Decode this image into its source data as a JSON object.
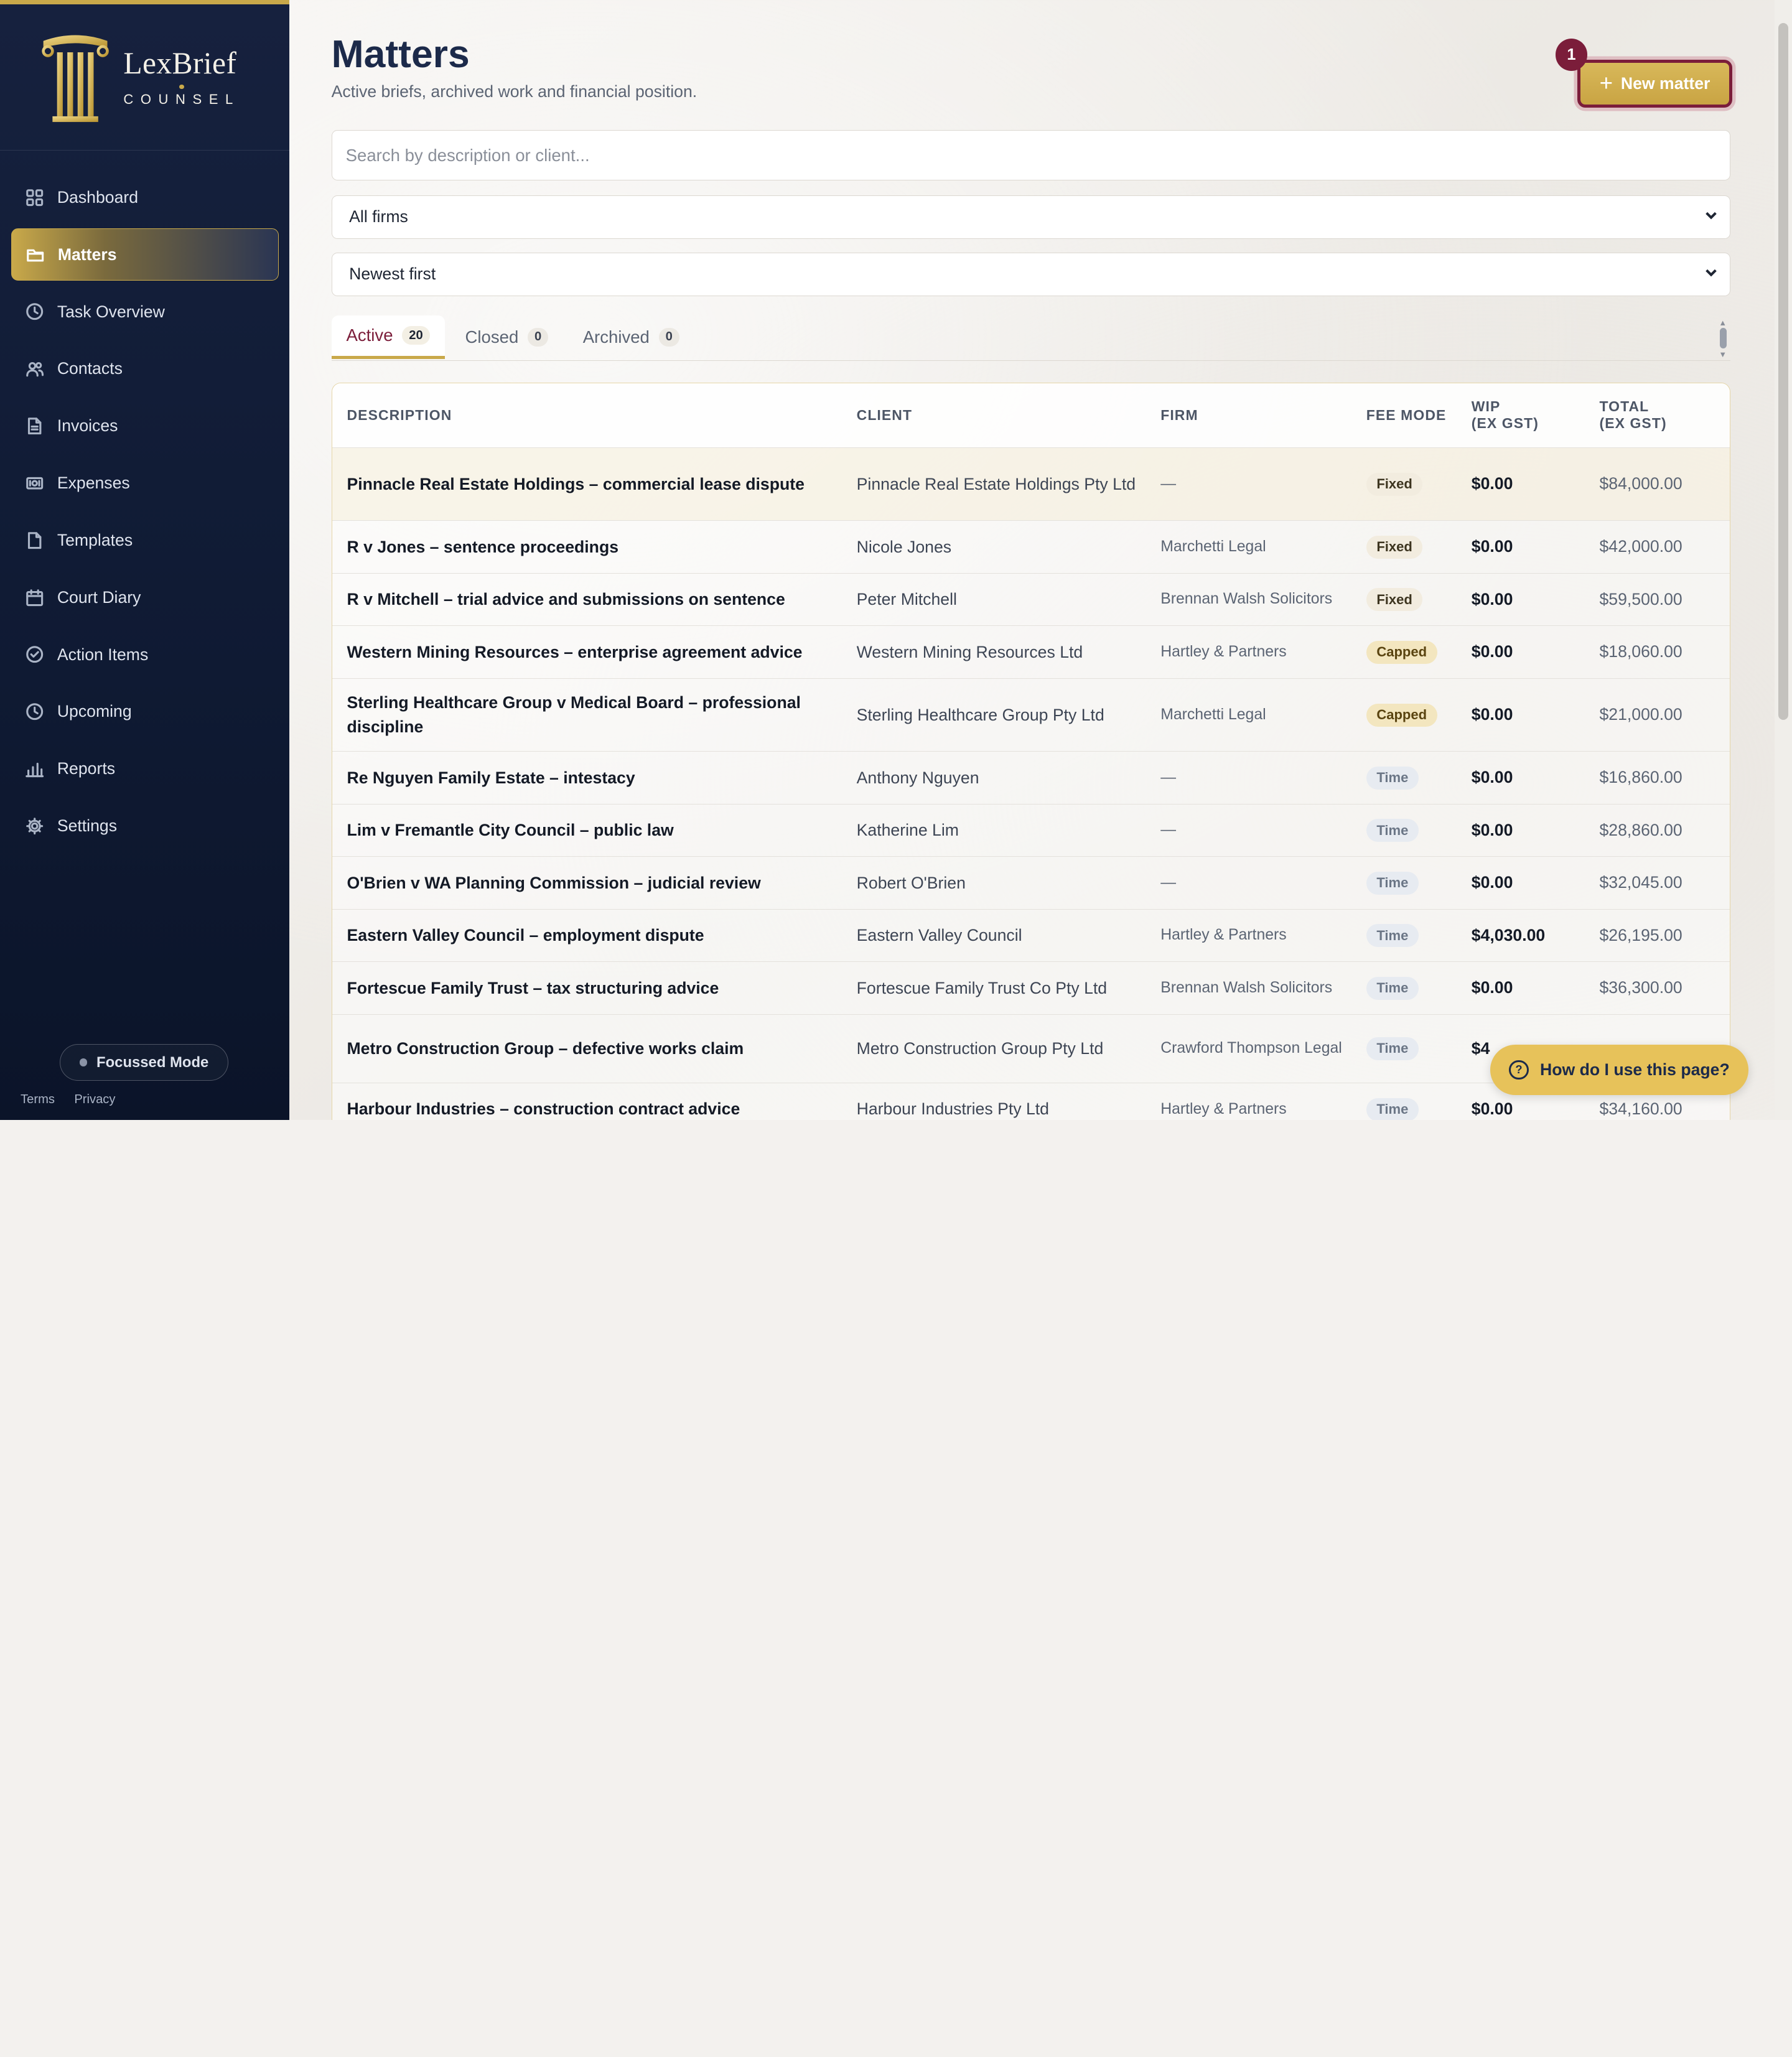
{
  "brand": {
    "name": "LexBrief",
    "sub": "COUNSEL"
  },
  "sidebar": {
    "items": [
      {
        "label": "Dashboard",
        "icon": "grid-icon",
        "active": false
      },
      {
        "label": "Matters",
        "icon": "folder-icon",
        "active": true
      },
      {
        "label": "Task Overview",
        "icon": "clock-icon",
        "active": false
      },
      {
        "label": "Contacts",
        "icon": "users-icon",
        "active": false
      },
      {
        "label": "Invoices",
        "icon": "file-text-icon",
        "active": false
      },
      {
        "label": "Expenses",
        "icon": "banknote-icon",
        "active": false
      },
      {
        "label": "Templates",
        "icon": "file-icon",
        "active": false
      },
      {
        "label": "Court Diary",
        "icon": "calendar-icon",
        "active": false
      },
      {
        "label": "Action Items",
        "icon": "check-circle-icon",
        "active": false
      },
      {
        "label": "Upcoming",
        "icon": "clock-icon",
        "active": false
      },
      {
        "label": "Reports",
        "icon": "bar-chart-icon",
        "active": false
      },
      {
        "label": "Settings",
        "icon": "gear-icon",
        "active": false
      }
    ],
    "focus_mode": "Focussed Mode",
    "footer": {
      "terms": "Terms",
      "privacy": "Privacy"
    }
  },
  "header": {
    "title": "Matters",
    "subtitle": "Active briefs, archived work and financial position.",
    "new_button": "New matter",
    "badge": "1"
  },
  "filters": {
    "search_placeholder": "Search by description or client...",
    "firm_select": "All firms",
    "sort_select": "Newest first"
  },
  "tabs": [
    {
      "label": "Active",
      "count": "20",
      "active": true
    },
    {
      "label": "Closed",
      "count": "0",
      "active": false
    },
    {
      "label": "Archived",
      "count": "0",
      "active": false
    }
  ],
  "table": {
    "columns": {
      "description": "DESCRIPTION",
      "client": "CLIENT",
      "firm": "FIRM",
      "fee_mode": "FEE MODE",
      "wip": "WIP",
      "wip_sub": "(EX GST)",
      "total": "TOTAL",
      "total_sub": "(EX GST)"
    },
    "rows": [
      {
        "description": "Pinnacle Real Estate Holdings – commercial lease dispute",
        "client": "Pinnacle Real Estate Holdings Pty Ltd",
        "firm": "—",
        "fee_mode": "Fixed",
        "wip": "$0.00",
        "total": "$84,000.00"
      },
      {
        "description": "R v Jones – sentence proceedings",
        "client": "Nicole Jones",
        "firm": "Marchetti Legal",
        "fee_mode": "Fixed",
        "wip": "$0.00",
        "total": "$42,000.00"
      },
      {
        "description": "R v Mitchell – trial advice and submissions on sentence",
        "client": "Peter Mitchell",
        "firm": "Brennan Walsh Solicitors",
        "fee_mode": "Fixed",
        "wip": "$0.00",
        "total": "$59,500.00"
      },
      {
        "description": "Western Mining Resources – enterprise agreement advice",
        "client": "Western Mining Resources Ltd",
        "firm": "Hartley & Partners",
        "fee_mode": "Capped",
        "wip": "$0.00",
        "total": "$18,060.00"
      },
      {
        "description": "Sterling Healthcare Group v Medical Board – professional discipline",
        "client": "Sterling Healthcare Group Pty Ltd",
        "firm": "Marchetti Legal",
        "fee_mode": "Capped",
        "wip": "$0.00",
        "total": "$21,000.00"
      },
      {
        "description": "Re Nguyen Family Estate – intestacy",
        "client": "Anthony Nguyen",
        "firm": "—",
        "fee_mode": "Time",
        "wip": "$0.00",
        "total": "$16,860.00"
      },
      {
        "description": "Lim v Fremantle City Council – public law",
        "client": "Katherine Lim",
        "firm": "—",
        "fee_mode": "Time",
        "wip": "$0.00",
        "total": "$28,860.00"
      },
      {
        "description": "O'Brien v WA Planning Commission – judicial review",
        "client": "Robert O'Brien",
        "firm": "—",
        "fee_mode": "Time",
        "wip": "$0.00",
        "total": "$32,045.00"
      },
      {
        "description": "Eastern Valley Council – employment dispute",
        "client": "Eastern Valley Council",
        "firm": "Hartley & Partners",
        "fee_mode": "Time",
        "wip": "$4,030.00",
        "total": "$26,195.00"
      },
      {
        "description": "Fortescue Family Trust – tax structuring advice",
        "client": "Fortescue Family Trust Co Pty Ltd",
        "firm": "Brennan Walsh Solicitors",
        "fee_mode": "Time",
        "wip": "$0.00",
        "total": "$36,300.00"
      },
      {
        "description": "Metro Construction Group – defective works claim",
        "client": "Metro Construction Group Pty Ltd",
        "firm": "Crawford Thompson Legal",
        "fee_mode": "Time",
        "wip": "$4",
        "total": ""
      },
      {
        "description": "Harbour Industries – construction contract advice",
        "client": "Harbour Industries Pty Ltd",
        "firm": "Hartley & Partners",
        "fee_mode": "Time",
        "wip": "$0.00",
        "total": "$34,160.00"
      }
    ]
  },
  "help_button": "How do I use this page?",
  "colors": {
    "accent_gold": "#c9a94a",
    "accent_maroon": "#7b1d3a",
    "sidebar_bg": "#16213e"
  }
}
